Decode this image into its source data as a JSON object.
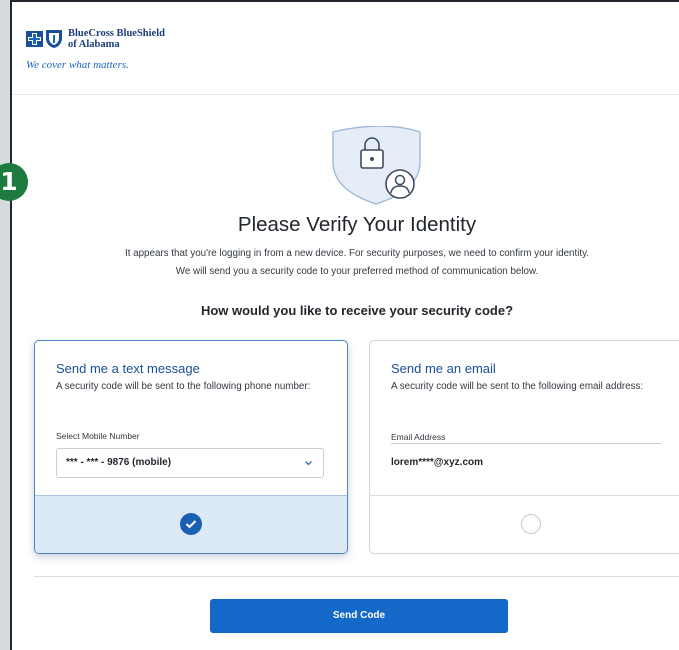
{
  "step_badge": "1",
  "brand": {
    "name_line1": "BlueCross BlueShield",
    "name_line2": "of Alabama",
    "tagline": "We cover what matters."
  },
  "page": {
    "title": "Please Verify Your Identity",
    "desc_line1": "It appears that you're logging in from a new device. For security purposes, we need to confirm your identity.",
    "desc_line2": "We will send you a security code to your preferred method of communication below.",
    "question": "How would you like to receive your security code?"
  },
  "text_option": {
    "title": "Send me a text message",
    "desc": "A security code will be sent to the following phone number:",
    "field_label": "Select Mobile Number",
    "selected_number": "*** - *** - 9876 (mobile)",
    "selected": true
  },
  "email_option": {
    "title": "Send me an email",
    "desc": "A security code will be sent to the following email address:",
    "field_label": "Email Address",
    "value": "lorem****@xyz.com",
    "selected": false
  },
  "actions": {
    "send_label": "Send Code"
  },
  "colors": {
    "brand_blue": "#1a3d7c",
    "link_blue": "#1a67c4",
    "primary_button": "#1468c7",
    "selected_card_border": "#4d84c8",
    "selected_card_footer": "#dce9f7",
    "badge_green": "#1e7b3f"
  },
  "icons": {
    "logo_cross": "bluecross-icon",
    "logo_shield": "blueshield-icon",
    "hero": "shield-lock-user-icon",
    "select_chevron": "chevron-down-icon",
    "radio_selected": "check-circle-icon",
    "radio_unselected": "empty-circle-icon"
  }
}
